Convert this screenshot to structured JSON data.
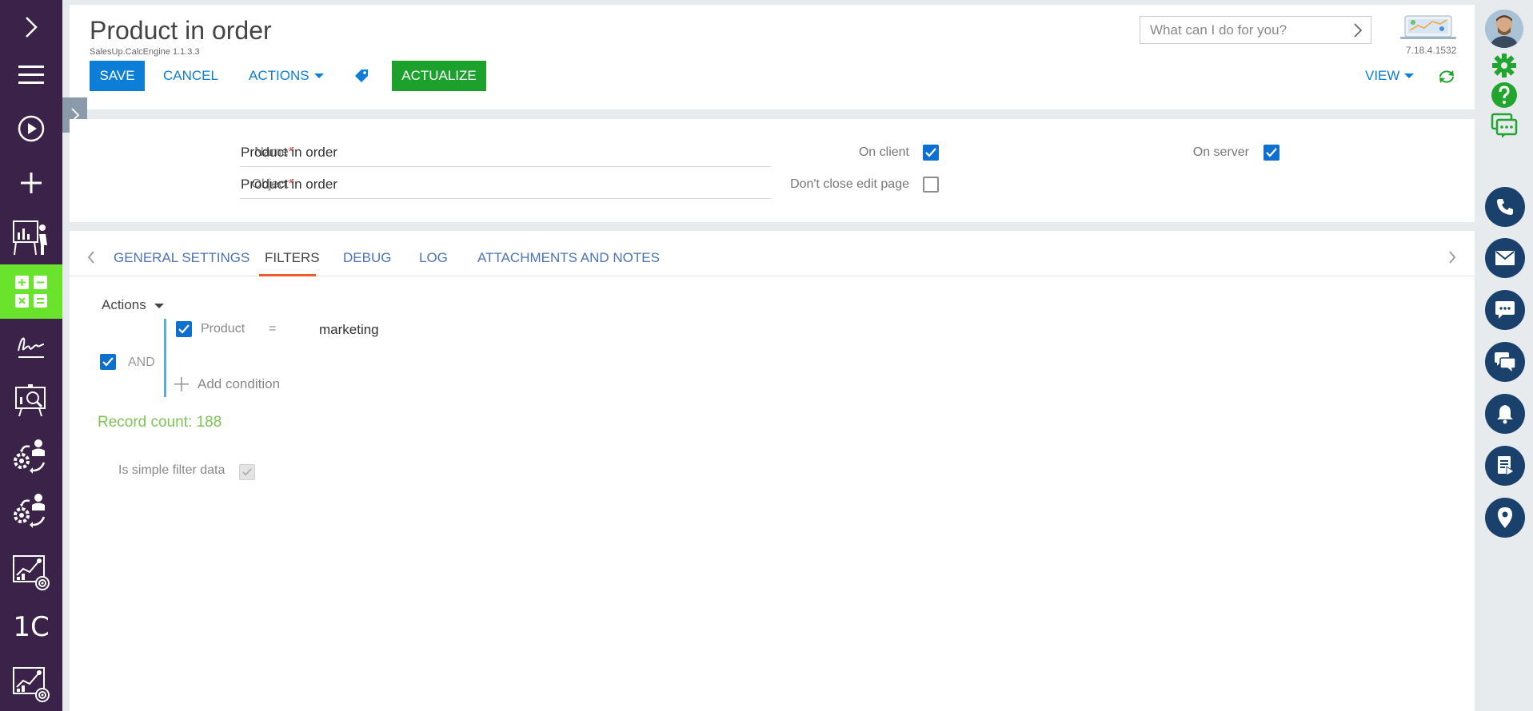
{
  "left_nav": {
    "items": [
      {
        "name": "expand-menu-icon"
      },
      {
        "name": "hamburger-menu-icon"
      },
      {
        "name": "play-process-icon"
      },
      {
        "name": "add-plus-icon"
      },
      {
        "name": "presentation-analytics-icon"
      },
      {
        "name": "calculator-grid-icon",
        "active": true
      },
      {
        "name": "signature-icon"
      },
      {
        "name": "board-search-icon"
      },
      {
        "name": "process-user-icon"
      },
      {
        "name": "process-user-icon-2"
      },
      {
        "name": "chart-target-icon"
      },
      {
        "name": "one-c-icon",
        "text": "1C"
      },
      {
        "name": "chart-target-icon-2"
      }
    ],
    "active_color": "#6ae32c",
    "bg_color": "#3a2249"
  },
  "header": {
    "title": "Product in order",
    "subtitle": "SalesUp.CalcEngine 1.1.3.3",
    "save_label": "SAVE",
    "cancel_label": "CANCEL",
    "actions_label": "ACTIONS",
    "actualize_label": "ACTUALIZE",
    "search_placeholder": "What can I do for you?",
    "version": "7.18.4.1532",
    "view_label": "VIEW"
  },
  "form": {
    "name_label": "Name",
    "name_value": "Product in order",
    "object_label": "Object",
    "object_value": "Product in order",
    "required_mark": "*",
    "on_client_label": "On client",
    "on_client_checked": true,
    "dont_close_label": "Don't close edit page",
    "dont_close_checked": false,
    "on_server_label": "On server",
    "on_server_checked": true
  },
  "tabs": [
    {
      "label": "GENERAL SETTINGS",
      "active": false
    },
    {
      "label": "FILTERS",
      "active": true
    },
    {
      "label": "DEBUG",
      "active": false
    },
    {
      "label": "LOG",
      "active": false
    },
    {
      "label": "ATTACHMENTS AND NOTES",
      "active": false
    }
  ],
  "filters": {
    "actions_label": "Actions",
    "group_operator": "AND",
    "group_checked": true,
    "conditions": [
      {
        "field": "Product",
        "operator": "=",
        "value": "marketing",
        "checked": true
      }
    ],
    "add_condition_label": "Add condition",
    "record_count_text": "Record count: 188",
    "simple_filter_label": "Is simple filter data",
    "simple_filter_checked": true
  },
  "right_bar": {
    "items": [
      "user-avatar",
      "settings-gear-icon",
      "help-icon",
      "chat-feed-icon",
      "phone-icon",
      "email-icon",
      "message-icon",
      "conversations-icon",
      "notifications-bell-icon",
      "document-icon",
      "location-pin-icon"
    ],
    "circle_color": "#1a416c",
    "green_color": "#22a52e"
  }
}
